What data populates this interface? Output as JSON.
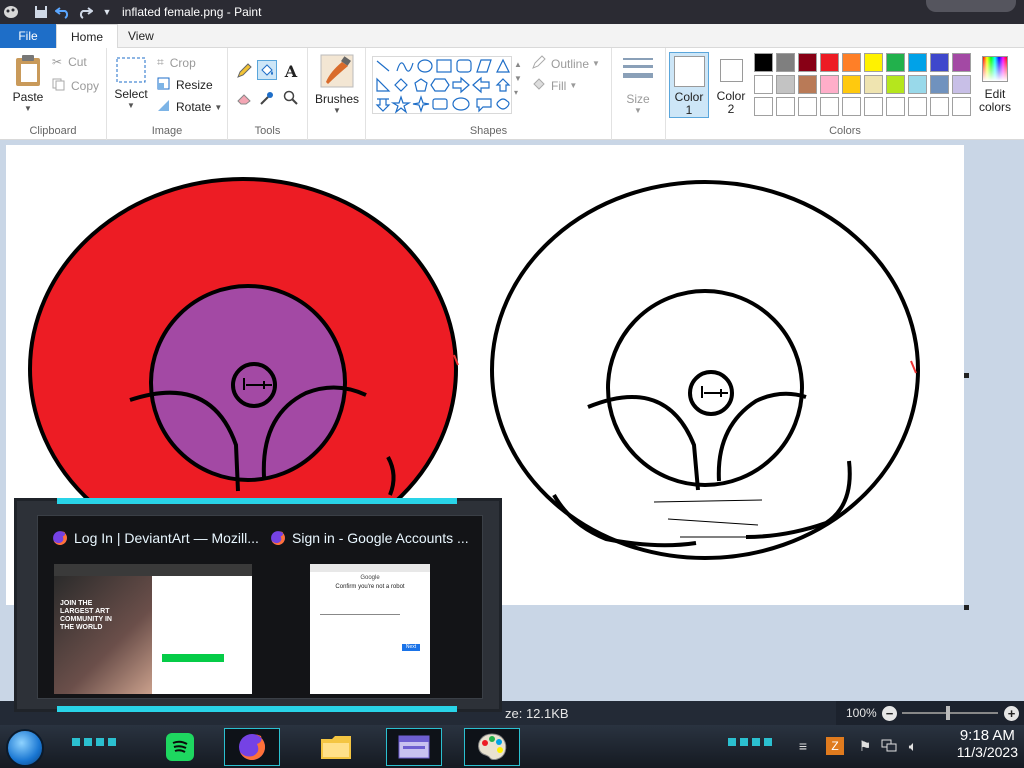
{
  "window": {
    "title": "inflated female.png - Paint"
  },
  "tabs": {
    "file": "File",
    "home": "Home",
    "view": "View"
  },
  "clipboard": {
    "paste": "Paste",
    "cut": "Cut",
    "copy": "Copy",
    "label": "Clipboard"
  },
  "image": {
    "select": "Select",
    "crop": "Crop",
    "resize": "Resize",
    "rotate": "Rotate",
    "label": "Image"
  },
  "tools": {
    "label": "Tools"
  },
  "brushes": {
    "label": "Brushes"
  },
  "shapes": {
    "outline": "Outline",
    "fill": "Fill",
    "label": "Shapes"
  },
  "size": {
    "label": "Size"
  },
  "colors": {
    "color1": "Color",
    "color1_num": "1",
    "color2": "Color",
    "color2_num": "2",
    "edit1": "Edit",
    "edit2": "colors",
    "label": "Colors",
    "palette": [
      "#000000",
      "#7f7f7f",
      "#880015",
      "#ed1c24",
      "#ff7f27",
      "#fff200",
      "#22b14c",
      "#00a2e8",
      "#3f48cc",
      "#a349a4",
      "#ffffff",
      "#c3c3c3",
      "#b97a57",
      "#ffaec9",
      "#ffc90e",
      "#efe4b0",
      "#b5e61d",
      "#99d9ea",
      "#7092be",
      "#c8bfe7",
      "#ffffff",
      "#ffffff",
      "#ffffff",
      "#ffffff",
      "#ffffff",
      "#ffffff",
      "#ffffff",
      "#ffffff",
      "#ffffff",
      "#ffffff"
    ]
  },
  "status": {
    "file_size": "ze: 12.1KB",
    "zoom": "100%"
  },
  "popup": {
    "item1": {
      "title": "Log In | DeviantArt — Mozill...",
      "headline": "JOIN THE LARGEST ART COMMUNITY IN THE WORLD"
    },
    "item2": {
      "title": "Sign in - Google Accounts ...",
      "heading": "Google",
      "subheading": "Confirm you're not a robot",
      "next": "Next"
    }
  },
  "clock": {
    "time": "9:18 AM",
    "date": "11/3/2023"
  }
}
